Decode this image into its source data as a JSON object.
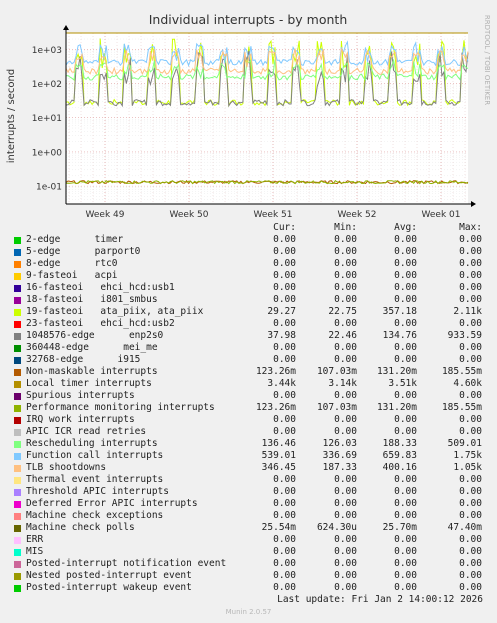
{
  "chart_data": {
    "type": "line",
    "title": "Individual interrupts - by month",
    "ylabel": "interrupts / second",
    "yscale": "log",
    "ylim": [
      0.03,
      3000
    ],
    "yticks": [
      {
        "value": 1000,
        "label": "1e+03"
      },
      {
        "value": 100,
        "label": "1e+02"
      },
      {
        "value": 10,
        "label": "1e+01"
      },
      {
        "value": 1,
        "label": "1e+00"
      },
      {
        "value": 0.1,
        "label": "1e-01"
      }
    ],
    "xticks": [
      "Week 49",
      "Week 50",
      "Week 51",
      "Week 52",
      "Week 01"
    ],
    "side_label": "RRDTOOL / TOBI OETIKER",
    "grid": true,
    "series": [
      {
        "name": "2-edge",
        "color": "#00cc00",
        "cur": "0.00",
        "min": "0.00",
        "avg": "0.00",
        "max": "0.00"
      },
      {
        "name": "5-edge",
        "color": "#0066b3",
        "cur": "0.00",
        "min": "0.00",
        "avg": "0.00",
        "max": "0.00"
      },
      {
        "name": "8-edge",
        "color": "#ff8000",
        "cur": "0.00",
        "min": "0.00",
        "avg": "0.00",
        "max": "0.00"
      },
      {
        "name": "9-fasteoi",
        "color": "#ffcc00",
        "cur": "0.00",
        "min": "0.00",
        "avg": "0.00",
        "max": "0.00"
      },
      {
        "name": "16-fasteoi",
        "color": "#330099",
        "cur": "0.00",
        "min": "0.00",
        "avg": "0.00",
        "max": "0.00"
      },
      {
        "name": "18-fasteoi",
        "color": "#990099",
        "cur": "0.00",
        "min": "0.00",
        "avg": "0.00",
        "max": "0.00"
      },
      {
        "name": "19-fasteoi",
        "color": "#ccff00",
        "cur": "29.27",
        "min": "22.75",
        "avg": "357.18",
        "max": "2.11k"
      },
      {
        "name": "23-fasteoi",
        "color": "#ff0000",
        "cur": "0.00",
        "min": "0.00",
        "avg": "0.00",
        "max": "0.00"
      },
      {
        "name": "1048576-edge",
        "color": "#808080",
        "cur": "37.98",
        "min": "22.46",
        "avg": "134.76",
        "max": "933.59"
      },
      {
        "name": "360448-edge",
        "color": "#008f00",
        "cur": "0.00",
        "min": "0.00",
        "avg": "0.00",
        "max": "0.00"
      },
      {
        "name": "32768-edge",
        "color": "#00487d",
        "cur": "0.00",
        "min": "0.00",
        "avg": "0.00",
        "max": "0.00"
      },
      {
        "name": "Non-maskable interrupts",
        "color": "#b35a00",
        "cur": "123.26m",
        "min": "107.03m",
        "avg": "131.20m",
        "max": "185.55m"
      },
      {
        "name": "Local timer interrupts",
        "color": "#b38f00",
        "cur": "3.44k",
        "min": "3.14k",
        "avg": "3.51k",
        "max": "4.60k"
      },
      {
        "name": "Spurious interrupts",
        "color": "#6b006b",
        "cur": "0.00",
        "min": "0.00",
        "avg": "0.00",
        "max": "0.00"
      },
      {
        "name": "Performance monitoring interrupts",
        "color": "#8fb300",
        "cur": "123.26m",
        "min": "107.03m",
        "avg": "131.20m",
        "max": "185.55m"
      },
      {
        "name": "IRQ work interrupts",
        "color": "#b30000",
        "cur": "0.00",
        "min": "0.00",
        "avg": "0.00",
        "max": "0.00"
      },
      {
        "name": "APIC ICR read retries",
        "color": "#bebebe",
        "cur": "0.00",
        "min": "0.00",
        "avg": "0.00",
        "max": "0.00"
      },
      {
        "name": "Rescheduling interrupts",
        "color": "#80ff80",
        "cur": "136.46",
        "min": "126.03",
        "avg": "188.33",
        "max": "509.01"
      },
      {
        "name": "Function call interrupts",
        "color": "#80c9ff",
        "cur": "539.01",
        "min": "336.69",
        "avg": "659.83",
        "max": "1.75k"
      },
      {
        "name": "TLB shootdowns",
        "color": "#ffc080",
        "cur": "346.45",
        "min": "187.33",
        "avg": "400.16",
        "max": "1.05k"
      },
      {
        "name": "Thermal event interrupts",
        "color": "#ffe680",
        "cur": "0.00",
        "min": "0.00",
        "avg": "0.00",
        "max": "0.00"
      },
      {
        "name": "Threshold APIC interrupts",
        "color": "#aa80ff",
        "cur": "0.00",
        "min": "0.00",
        "avg": "0.00",
        "max": "0.00"
      },
      {
        "name": "Deferred Error APIC interrupts",
        "color": "#ee00cc",
        "cur": "0.00",
        "min": "0.00",
        "avg": "0.00",
        "max": "0.00"
      },
      {
        "name": "Machine check exceptions",
        "color": "#ff8080",
        "cur": "0.00",
        "min": "0.00",
        "avg": "0.00",
        "max": "0.00"
      },
      {
        "name": "Machine check polls",
        "color": "#666600",
        "cur": "25.54m",
        "min": "624.30u",
        "avg": "25.70m",
        "max": "47.40m"
      },
      {
        "name": "ERR",
        "color": "#ffbfff",
        "cur": "0.00",
        "min": "0.00",
        "avg": "0.00",
        "max": "0.00"
      },
      {
        "name": "MIS",
        "color": "#00ffcc",
        "cur": "0.00",
        "min": "0.00",
        "avg": "0.00",
        "max": "0.00"
      },
      {
        "name": "Posted-interrupt notification event",
        "color": "#cc6699",
        "cur": "0.00",
        "min": "0.00",
        "avg": "0.00",
        "max": "0.00"
      },
      {
        "name": "Nested posted-interrupt event",
        "color": "#999900",
        "cur": "0.00",
        "min": "0.00",
        "avg": "0.00",
        "max": "0.00"
      },
      {
        "name": "Posted-interrupt wakeup event",
        "color": "#00cc00",
        "cur": "0.00",
        "min": "0.00",
        "avg": "0.00",
        "max": "0.00"
      }
    ]
  },
  "legend": {
    "labels": [
      "2-edge      timer",
      "5-edge      parport0",
      "8-edge      rtc0",
      "9-fasteoi   acpi",
      "16-fasteoi   ehci_hcd:usb1",
      "18-fasteoi   i801_smbus",
      "19-fasteoi   ata_piix, ata_piix",
      "23-fasteoi   ehci_hcd:usb2",
      "1048576-edge      enp2s0",
      "360448-edge      mei_me",
      "32768-edge      i915",
      "Non-maskable interrupts",
      "Local timer interrupts",
      "Spurious interrupts",
      "Performance monitoring interrupts",
      "IRQ work interrupts",
      "APIC ICR read retries",
      "Rescheduling interrupts",
      "Function call interrupts",
      "TLB shootdowns",
      "Thermal event interrupts",
      "Threshold APIC interrupts",
      "Deferred Error APIC interrupts",
      "Machine check exceptions",
      "Machine check polls",
      "ERR",
      "MIS",
      "Posted-interrupt notification event",
      "Nested posted-interrupt event",
      "Posted-interrupt wakeup event"
    ],
    "headers": {
      "cur": "Cur:",
      "min": "Min:",
      "avg": "Avg:",
      "max": "Max:"
    }
  },
  "footer": {
    "last_update": "Last update: Fri Jan  2 14:00:12 2026",
    "version": "Munin 2.0.57"
  }
}
